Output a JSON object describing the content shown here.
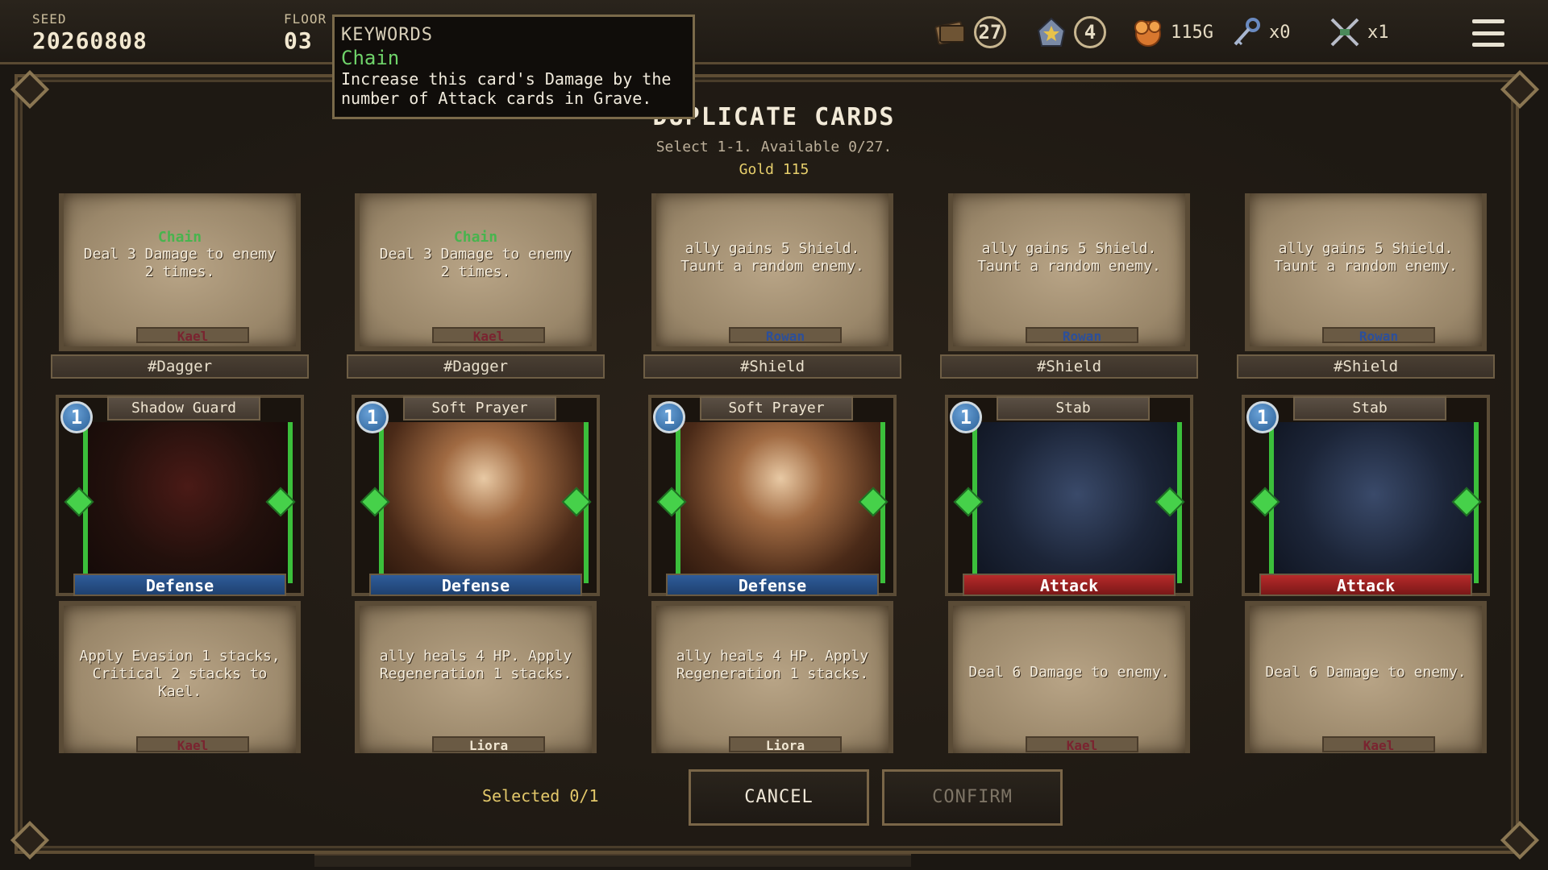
{
  "topbar": {
    "seed_label": "SEED",
    "seed_value": "20260808",
    "floor_label": "FLOOR",
    "floor_value": "03",
    "deck_count": "27",
    "star_count": "4",
    "gold": "115G",
    "keys": "x0",
    "swords": "x1"
  },
  "tooltip": {
    "header": "KEYWORDS",
    "name": "Chain",
    "description": "Increase this card's Damage by the number of Attack cards in Grave."
  },
  "dialog": {
    "title": "DUPLICATE CARDS",
    "subtitle": "Select 1-1. Available 0/27.",
    "gold": "Gold 115"
  },
  "upper_cards": [
    {
      "keyword": "Chain",
      "desc": "Deal 3 Damage to enemy 2 times.",
      "owner": "Kael",
      "tag": "#Dagger"
    },
    {
      "keyword": "Chain",
      "desc": "Deal 3 Damage to enemy 2 times.",
      "owner": "Kael",
      "tag": "#Dagger"
    },
    {
      "keyword": "",
      "desc": "ally gains 5 Shield. Taunt a random enemy.",
      "owner": "Rowan",
      "tag": "#Shield"
    },
    {
      "keyword": "",
      "desc": "ally gains 5 Shield. Taunt a random enemy.",
      "owner": "Rowan",
      "tag": "#Shield"
    },
    {
      "keyword": "",
      "desc": "ally gains 5 Shield. Taunt a random enemy.",
      "owner": "Rowan",
      "tag": "#Shield"
    }
  ],
  "lower_cards": [
    {
      "cost": "1",
      "name": "Shadow Guard",
      "type": "Defense",
      "desc": "Apply Evasion 1 stacks, Critical 2 stacks to Kael.",
      "owner": "Kael"
    },
    {
      "cost": "1",
      "name": "Soft Prayer",
      "type": "Defense",
      "desc": "ally heals 4 HP. Apply Regeneration 1 stacks.",
      "owner": "Liora"
    },
    {
      "cost": "1",
      "name": "Soft Prayer",
      "type": "Defense",
      "desc": "ally heals 4 HP. Apply Regeneration 1 stacks.",
      "owner": "Liora"
    },
    {
      "cost": "1",
      "name": "Stab",
      "type": "Attack",
      "desc": "Deal 6 Damage to enemy.",
      "owner": "Kael"
    },
    {
      "cost": "1",
      "name": "Stab",
      "type": "Attack",
      "desc": "Deal 6 Damage to enemy.",
      "owner": "Kael"
    }
  ],
  "footer": {
    "selected": "Selected 0/1",
    "cancel": "CANCEL",
    "confirm": "CONFIRM"
  },
  "icons": {
    "deck": "deck-icon",
    "star": "star-house-icon",
    "gold": "gold-coins-icon",
    "key": "key-icon",
    "swords": "crossed-swords-icon",
    "menu": "hamburger-menu-icon"
  },
  "colors": {
    "keyword_green": "#48b44e",
    "damage_orange": "#e0a84a",
    "defense_blue": "#2e5c9a",
    "attack_red": "#b72a2a",
    "gold_yellow": "#e7cf6c"
  }
}
